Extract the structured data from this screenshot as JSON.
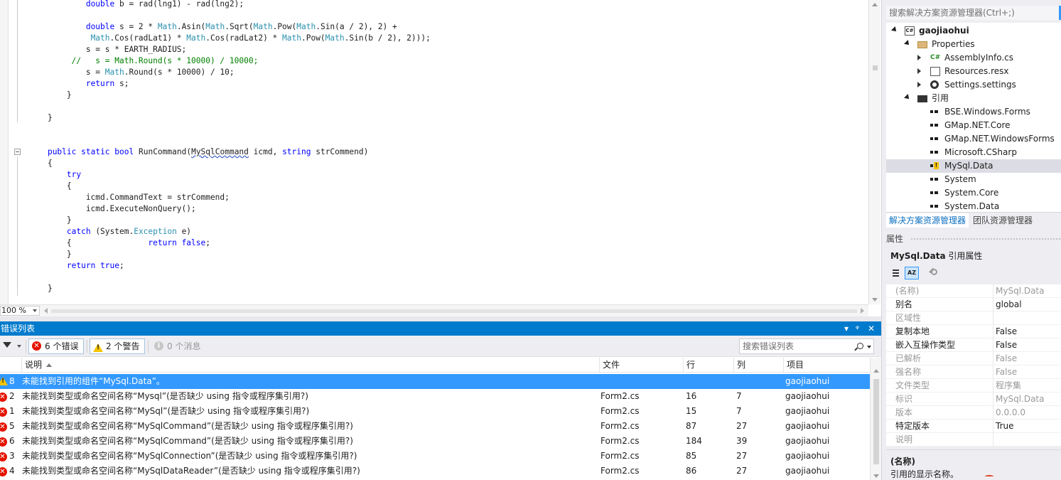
{
  "editor": {
    "lines": [
      {
        "parts": [
          {
            "t": "            "
          },
          {
            "t": "double",
            "c": "kw"
          },
          {
            "t": " b = rad(lng1) - rad(lng2);"
          }
        ]
      },
      {
        "parts": []
      },
      {
        "parts": [
          {
            "t": "            "
          },
          {
            "t": "double",
            "c": "kw"
          },
          {
            "t": " s = 2 * "
          },
          {
            "t": "Math",
            "c": "ty"
          },
          {
            "t": ".Asin("
          },
          {
            "t": "Math",
            "c": "ty"
          },
          {
            "t": ".Sqrt("
          },
          {
            "t": "Math",
            "c": "ty"
          },
          {
            "t": ".Pow("
          },
          {
            "t": "Math",
            "c": "ty"
          },
          {
            "t": ".Sin(a / 2), 2) +"
          }
        ]
      },
      {
        "parts": [
          {
            "t": "             "
          },
          {
            "t": "Math",
            "c": "ty"
          },
          {
            "t": ".Cos(radLat1) * "
          },
          {
            "t": "Math",
            "c": "ty"
          },
          {
            "t": ".Cos(radLat2) * "
          },
          {
            "t": "Math",
            "c": "ty"
          },
          {
            "t": ".Pow("
          },
          {
            "t": "Math",
            "c": "ty"
          },
          {
            "t": ".Sin(b / 2), 2)));"
          }
        ]
      },
      {
        "parts": [
          {
            "t": "            s = s * EARTH_RADIUS;"
          }
        ]
      },
      {
        "parts": [
          {
            "t": "         //   s = Math.Round(s * 10000) / 10000;",
            "c": "cm"
          }
        ]
      },
      {
        "parts": [
          {
            "t": "            s = "
          },
          {
            "t": "Math",
            "c": "ty"
          },
          {
            "t": ".Round(s * 10000) / 10;"
          }
        ]
      },
      {
        "parts": [
          {
            "t": "            "
          },
          {
            "t": "return",
            "c": "kw"
          },
          {
            "t": " s;"
          }
        ]
      },
      {
        "parts": [
          {
            "t": "        }"
          }
        ]
      },
      {
        "parts": []
      },
      {
        "parts": [
          {
            "t": "    }"
          }
        ]
      },
      {
        "parts": []
      },
      {
        "parts": []
      },
      {
        "parts": [
          {
            "t": "    "
          },
          {
            "t": "public",
            "c": "kw"
          },
          {
            "t": " "
          },
          {
            "t": "static",
            "c": "kw"
          },
          {
            "t": " "
          },
          {
            "t": "bool",
            "c": "kw"
          },
          {
            "t": " RunCommand("
          },
          {
            "t": "MySqlCommand",
            "c": "sq"
          },
          {
            "t": " icmd, "
          },
          {
            "t": "string",
            "c": "kw"
          },
          {
            "t": " strCommend)"
          }
        ]
      },
      {
        "parts": [
          {
            "t": "    {"
          }
        ]
      },
      {
        "parts": [
          {
            "t": "        "
          },
          {
            "t": "try",
            "c": "kw"
          }
        ]
      },
      {
        "parts": [
          {
            "t": "        {"
          }
        ]
      },
      {
        "parts": [
          {
            "t": "            icmd.CommandText = strCommend;"
          }
        ]
      },
      {
        "parts": [
          {
            "t": "            icmd.ExecuteNonQuery();"
          }
        ]
      },
      {
        "parts": [
          {
            "t": "        }"
          }
        ]
      },
      {
        "parts": [
          {
            "t": "        "
          },
          {
            "t": "catch",
            "c": "kw"
          },
          {
            "t": " (System."
          },
          {
            "t": "Exception",
            "c": "ty"
          },
          {
            "t": " e)"
          }
        ]
      },
      {
        "parts": [
          {
            "t": "        {                "
          },
          {
            "t": "return",
            "c": "kw"
          },
          {
            "t": " "
          },
          {
            "t": "false",
            "c": "kw"
          },
          {
            "t": ";"
          }
        ]
      },
      {
        "parts": [
          {
            "t": "        }"
          }
        ]
      },
      {
        "parts": [
          {
            "t": "        "
          },
          {
            "t": "return",
            "c": "kw"
          },
          {
            "t": " "
          },
          {
            "t": "true",
            "c": "kw"
          },
          {
            "t": ";"
          }
        ]
      },
      {
        "parts": []
      },
      {
        "parts": [
          {
            "t": "    }"
          }
        ]
      }
    ],
    "zoom": "100 %"
  },
  "error_list": {
    "title": "错误列表",
    "errors_btn": "6 个错误",
    "warnings_btn": "2 个警告",
    "messages_btn": "0 个消息",
    "search_placeholder": "搜索错误列表",
    "columns": {
      "description": "说明",
      "file": "文件",
      "line": "行",
      "column": "列",
      "project": "项目"
    },
    "rows": [
      {
        "type": "warning",
        "num": "8",
        "desc": "未能找到引用的组件“MySql.Data”。",
        "file": "",
        "line": "",
        "col": "",
        "project": "gaojiaohui",
        "selected": true
      },
      {
        "type": "error",
        "num": "2",
        "desc": "未能找到类型或命名空间名称“Mysql”(是否缺少 using 指令或程序集引用?)",
        "file": "Form2.cs",
        "line": "16",
        "col": "7",
        "project": "gaojiaohui"
      },
      {
        "type": "error",
        "num": "1",
        "desc": "未能找到类型或命名空间名称“MySql”(是否缺少 using 指令或程序集引用?)",
        "file": "Form2.cs",
        "line": "15",
        "col": "7",
        "project": "gaojiaohui"
      },
      {
        "type": "error",
        "num": "5",
        "desc": "未能找到类型或命名空间名称“MySqlCommand”(是否缺少 using 指令或程序集引用?)",
        "file": "Form2.cs",
        "line": "87",
        "col": "27",
        "project": "gaojiaohui"
      },
      {
        "type": "error",
        "num": "6",
        "desc": "未能找到类型或命名空间名称“MySqlCommand”(是否缺少 using 指令或程序集引用?)",
        "file": "Form2.cs",
        "line": "184",
        "col": "39",
        "project": "gaojiaohui"
      },
      {
        "type": "error",
        "num": "3",
        "desc": "未能找到类型或命名空间名称“MySqlConnection”(是否缺少 using 指令或程序集引用?)",
        "file": "Form2.cs",
        "line": "85",
        "col": "27",
        "project": "gaojiaohui"
      },
      {
        "type": "error",
        "num": "4",
        "desc": "未能找到类型或命名空间名称“MySqlDataReader”(是否缺少 using 指令或程序集引用?)",
        "file": "Form2.cs",
        "line": "86",
        "col": "27",
        "project": "gaojiaohui"
      }
    ]
  },
  "solution_explorer": {
    "search_placeholder": "搜索解决方案资源管理器(Ctrl+;)",
    "nodes": [
      {
        "label": "gaojiaohui",
        "level": 0,
        "icon": "project-icon",
        "expander": "open",
        "bold": true
      },
      {
        "label": "Properties",
        "level": 1,
        "icon": "folder-icon",
        "expander": "open"
      },
      {
        "label": "AssemblyInfo.cs",
        "level": 2,
        "icon": "csharp-file-icon",
        "expander": "closed"
      },
      {
        "label": "Resources.resx",
        "level": 2,
        "icon": "resx-file-icon",
        "expander": "closed"
      },
      {
        "label": "Settings.settings",
        "level": 2,
        "icon": "settings-icon",
        "expander": "closed"
      },
      {
        "label": "引用",
        "level": 1,
        "icon": "references-folder-icon",
        "expander": "open"
      },
      {
        "label": "BSE.Windows.Forms",
        "level": 2,
        "icon": "reference-icon"
      },
      {
        "label": "GMap.NET.Core",
        "level": 2,
        "icon": "reference-icon"
      },
      {
        "label": "GMap.NET.WindowsForms",
        "level": 2,
        "icon": "reference-icon"
      },
      {
        "label": "Microsoft.CSharp",
        "level": 2,
        "icon": "reference-icon"
      },
      {
        "label": "MySql.Data",
        "level": 2,
        "icon": "reference-warning-icon",
        "selected": true
      },
      {
        "label": "System",
        "level": 2,
        "icon": "reference-icon"
      },
      {
        "label": "System.Core",
        "level": 2,
        "icon": "reference-icon"
      },
      {
        "label": "System.Data",
        "level": 2,
        "icon": "reference-icon"
      }
    ],
    "tabs": [
      "解决方案资源管理器",
      "团队资源管理器"
    ]
  },
  "properties": {
    "title": "属性",
    "object_name": "MySql.Data",
    "object_type": "引用属性",
    "rows": [
      {
        "key": "(名称)",
        "value": "MySql.Data",
        "dim": true
      },
      {
        "key": "别名",
        "value": "global"
      },
      {
        "key": "区域性",
        "value": "",
        "dim": true
      },
      {
        "key": "复制本地",
        "value": "False"
      },
      {
        "key": "嵌入互操作类型",
        "value": "False"
      },
      {
        "key": "已解析",
        "value": "False",
        "dim": true
      },
      {
        "key": "强名称",
        "value": "False",
        "dim": true
      },
      {
        "key": "文件类型",
        "value": "程序集",
        "dim": true
      },
      {
        "key": "标识",
        "value": "MySql.Data",
        "dim": true
      },
      {
        "key": "版本",
        "value": "0.0.0.0",
        "dim": true
      },
      {
        "key": "特定版本",
        "value": "True"
      },
      {
        "key": "说明",
        "value": "",
        "dim": true
      }
    ],
    "desc_title": "(名称)",
    "desc_text": "引用的显示名称。"
  }
}
